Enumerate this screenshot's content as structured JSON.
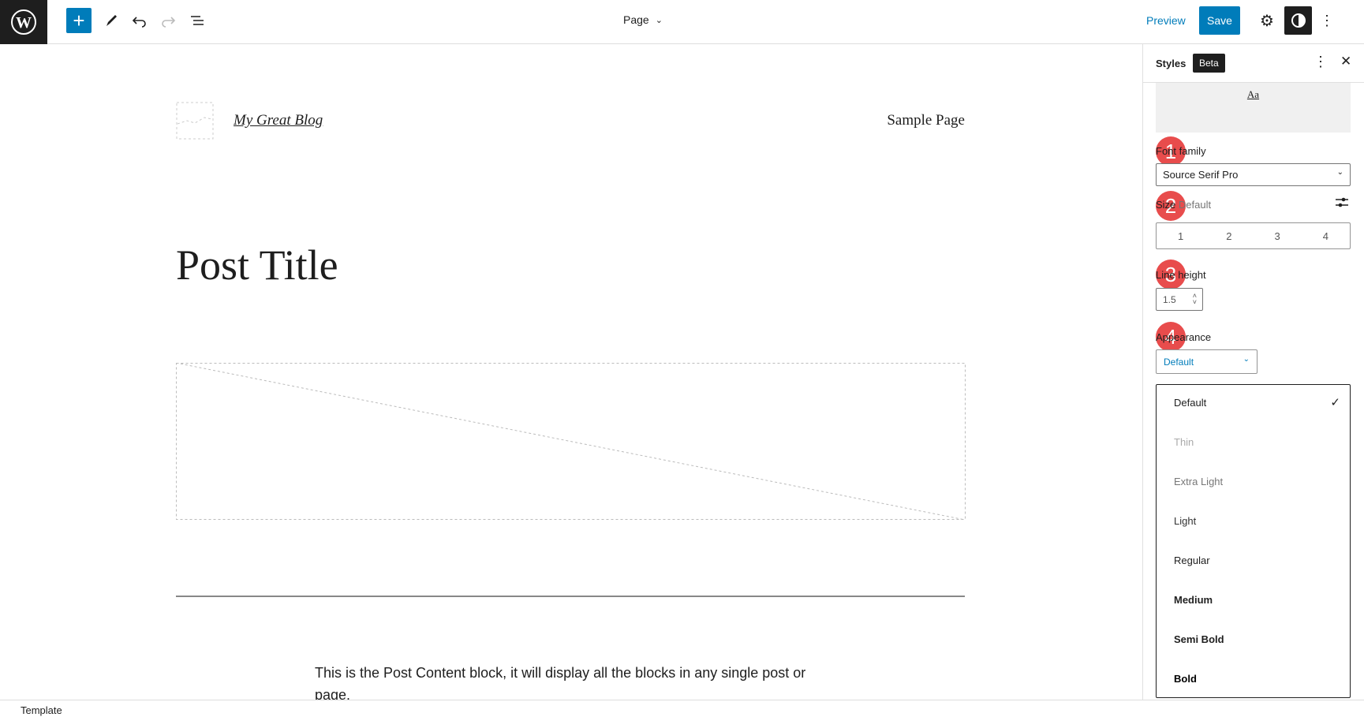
{
  "topbar": {
    "page_title": "Page",
    "preview": "Preview",
    "save": "Save"
  },
  "canvas": {
    "site_title": "My Great Blog",
    "nav_item": "Sample Page",
    "post_title": "Post Title",
    "paragraph": "This is the Post Content block, it will display all the blocks in any single post or page."
  },
  "sidebar": {
    "title": "Styles",
    "badge": "Beta",
    "preview_text": "Aa",
    "font_family": {
      "label": "Font family",
      "value": "Source Serif Pro"
    },
    "size": {
      "label": "Size",
      "value": "Default",
      "options": [
        "1",
        "2",
        "3",
        "4"
      ]
    },
    "line_height": {
      "label": "Line height",
      "value": "1.5"
    },
    "appearance": {
      "label": "Appearance",
      "value": "Default",
      "options": [
        "Default",
        "Thin",
        "Extra Light",
        "Light",
        "Regular",
        "Medium",
        "Semi Bold",
        "Bold"
      ],
      "selected": "Default"
    },
    "steps": [
      "1",
      "2",
      "3",
      "4"
    ]
  },
  "footer": {
    "breadcrumb": "Template"
  },
  "colors": {
    "accent": "#007cba",
    "step_marker": "#e84c4c",
    "dark": "#1e1e1e"
  }
}
